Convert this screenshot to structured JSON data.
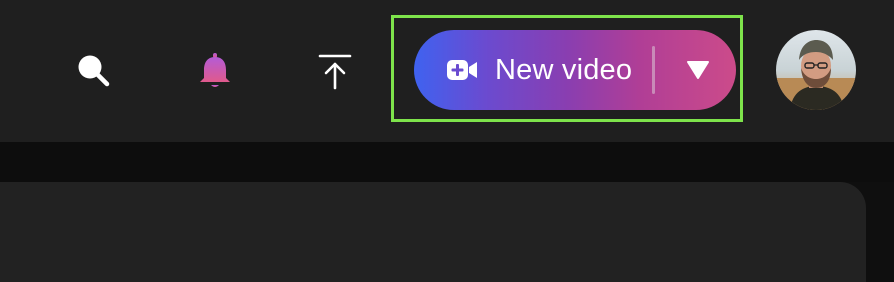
{
  "topbar": {
    "icons": {
      "search": "search-icon",
      "notifications": "bell-icon",
      "upload": "upload-icon"
    },
    "new_video_button": {
      "label": "New video",
      "icon": "video-plus-icon",
      "dropdown_icon": "caret-down-icon"
    },
    "avatar": "user-avatar"
  },
  "colors": {
    "topbar_bg": "#1f1f1f",
    "button_gradient_start": "#3f62f0",
    "button_gradient_end": "#cc4b8a",
    "bell_gradient_top": "#b45bd6",
    "bell_gradient_bottom": "#e05a8c",
    "highlight_border": "#7ee34b"
  }
}
